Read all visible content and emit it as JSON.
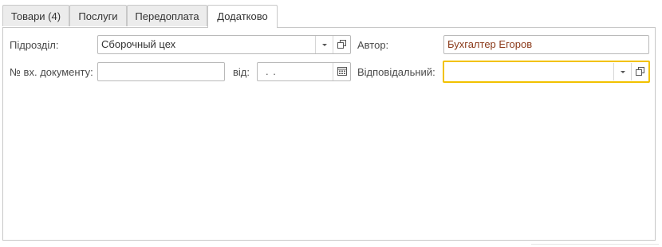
{
  "tabs": [
    {
      "label": "Товари (4)",
      "active": false
    },
    {
      "label": "Послуги",
      "active": false
    },
    {
      "label": "Передоплата",
      "active": false
    },
    {
      "label": "Додатково",
      "active": true
    }
  ],
  "form": {
    "subdivision_label": "Підрозділ:",
    "subdivision_value": "Сборочный цех",
    "author_label": "Автор:",
    "author_value": "Бухгалтер Егоров",
    "incoming_doc_label": "№ вх. документу:",
    "incoming_doc_value": "",
    "date_label": "від:",
    "date_value": ". .",
    "responsible_label": "Відповідальний:",
    "responsible_value": ""
  },
  "colors": {
    "author_text": "#8b3a1a",
    "focus_border": "#f2c200",
    "tab_bg": "#ececec",
    "border": "#c8c8c8"
  },
  "icons": {
    "dropdown": "chevron-down-icon",
    "open": "open-form-icon",
    "calendar": "calendar-icon"
  }
}
